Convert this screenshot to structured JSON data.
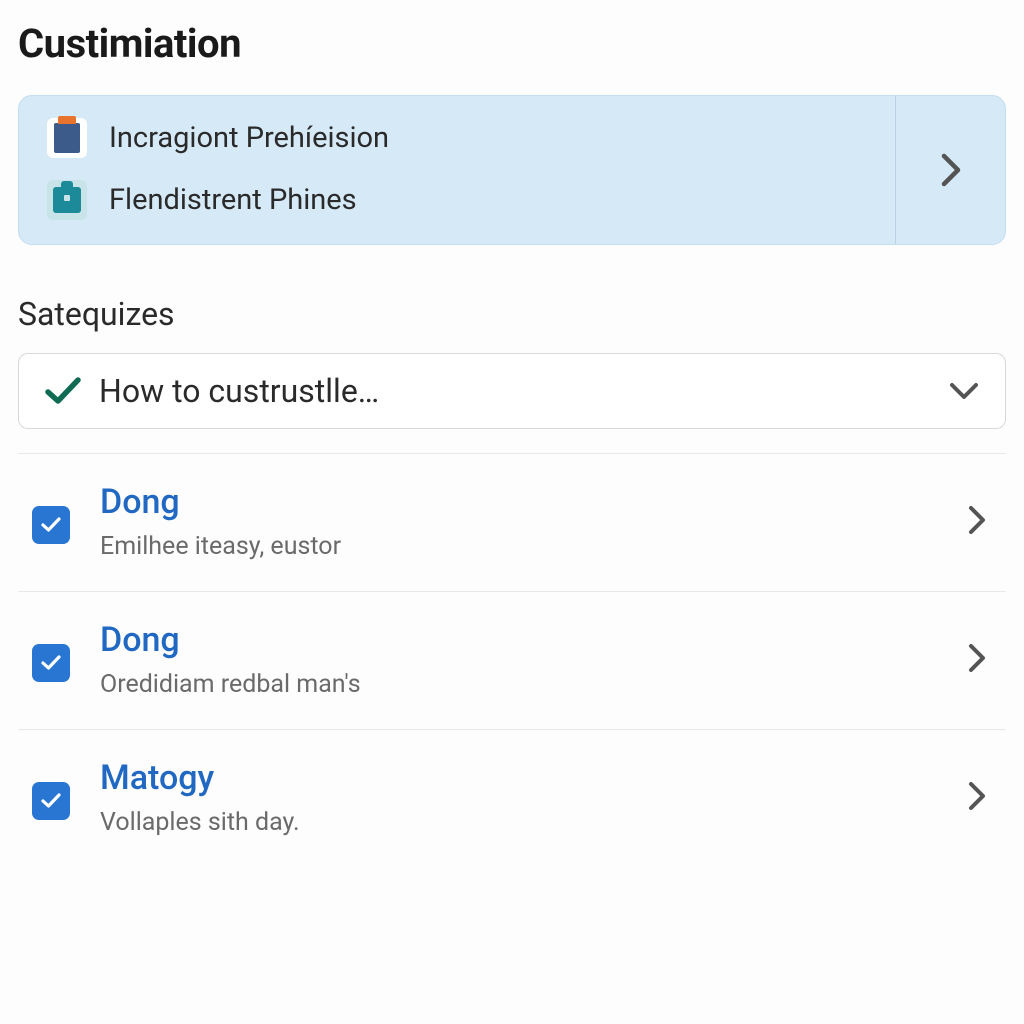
{
  "page": {
    "title": "Custimiation"
  },
  "banner": {
    "items": [
      {
        "icon": "clipboard-icon",
        "label": "Incragiont Prehíeision"
      },
      {
        "icon": "toolbox-icon",
        "label": "Flendistrent Phines"
      }
    ]
  },
  "section": {
    "title": "Satequizes"
  },
  "expander": {
    "label": "How to custrustlle…"
  },
  "list": {
    "items": [
      {
        "title": "Dong",
        "subtitle": "Emilhee iteasy, eustor",
        "checked": true
      },
      {
        "title": "Dong",
        "subtitle": "Oredidiam redbal man's",
        "checked": true
      },
      {
        "title": "Matogy",
        "subtitle": "Vollaples sith day.",
        "checked": true
      }
    ]
  },
  "colors": {
    "accent": "#2876d2",
    "banner_bg": "#d5e9f7",
    "link": "#2068c2",
    "check_green": "#0f6b53"
  }
}
